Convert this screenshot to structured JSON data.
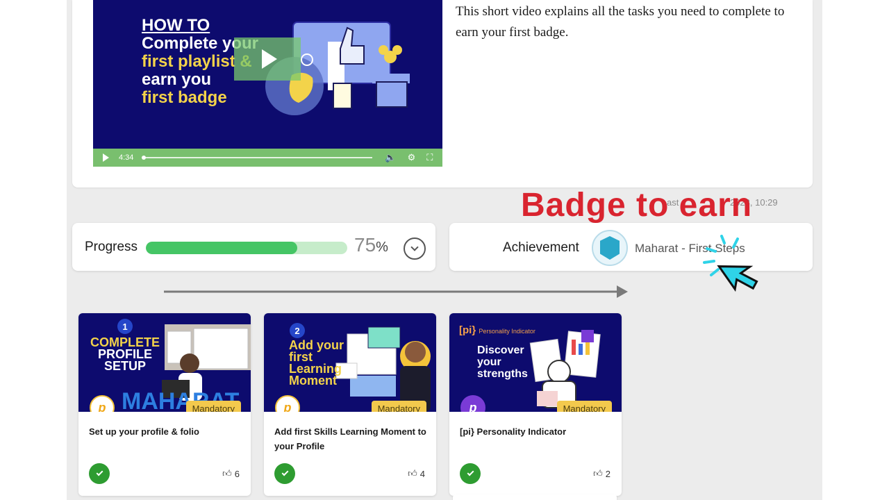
{
  "video": {
    "title_lines": [
      {
        "text": "HOW TO",
        "color": "white"
      },
      {
        "text": "Complete your",
        "color": "white"
      },
      {
        "text": "first playlist &",
        "color": "yellow"
      },
      {
        "text": "earn you",
        "color": "white"
      },
      {
        "text": "first badge",
        "color": "yellow"
      }
    ],
    "time": "4:34",
    "progress": 0.01
  },
  "description": "This short video explains all the tasks you need to complete to earn your first badge.",
  "last_updated": "ast",
  "last_updated_date": "2023, 10:29",
  "callout": "Badge to earn",
  "progress": {
    "label": "Progress",
    "percent": 75,
    "percent_number": "75",
    "percent_symbol": "%"
  },
  "achievement": {
    "label": "Achievement",
    "name": "Maharat - First Steps"
  },
  "tasks": [
    {
      "number": "1",
      "thumb_lines": [
        "COMPLETE",
        "PROFILE",
        "SETUP"
      ],
      "thumb_sub": "MAHARAT",
      "badge": "Mandatory",
      "logo": "p",
      "title": "Set up your profile & folio",
      "likes": "6"
    },
    {
      "number": "2",
      "thumb_lines": [
        "Add your",
        "first",
        "Learning",
        "Moment"
      ],
      "badge": "Mandatory",
      "logo": "p",
      "title": "Add first Skills Learning Moment to your Profile",
      "likes": "4"
    },
    {
      "number": "",
      "thumb_brand": "[pi}",
      "thumb_brand_sub": "Personality Indicator",
      "thumb_lines": [
        "Discover",
        "your",
        "strengths"
      ],
      "badge": "Mandatory",
      "logo": "p",
      "title": "[pi} Personality Indicator",
      "likes": "2"
    }
  ],
  "colors": {
    "accent_green": "#45c565",
    "callout_red": "#d9242f",
    "mandatory_yellow": "#f3c94d",
    "thumb_navy": "#0d0b6e"
  }
}
